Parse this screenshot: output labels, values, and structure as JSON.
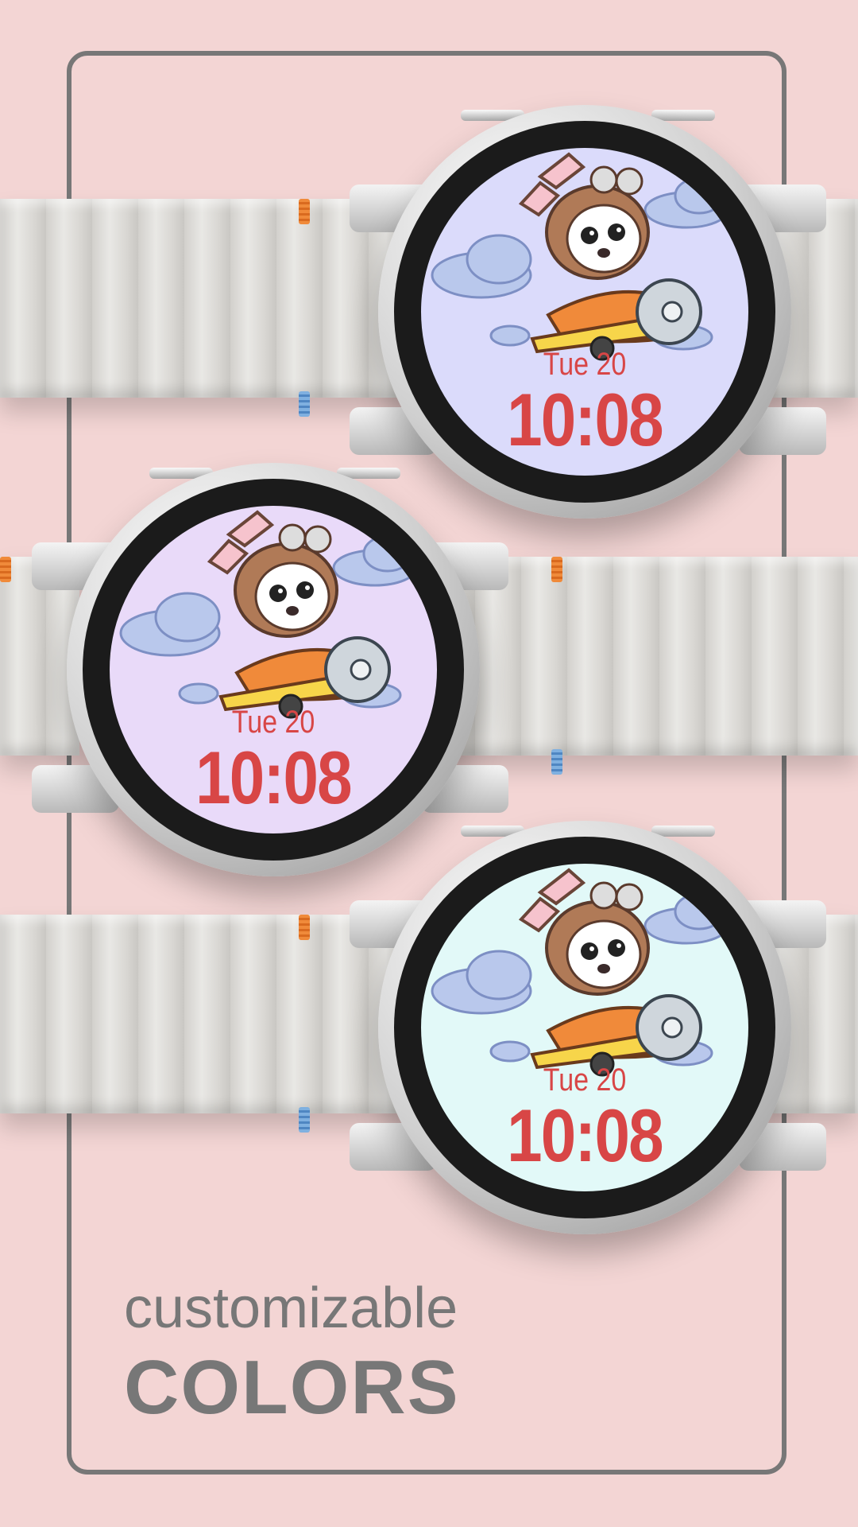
{
  "watches": [
    {
      "date": "Tue 20",
      "time": "10:08",
      "face_color": "#dbdbfb"
    },
    {
      "date": "Tue 20",
      "time": "10:08",
      "face_color": "#e9daf9"
    },
    {
      "date": "Tue 20",
      "time": "10:08",
      "face_color": "#e2f9f8"
    }
  ],
  "caption": {
    "line1": "customizable",
    "line2": "COLORS"
  },
  "colors": {
    "background": "#f3d5d4",
    "frame": "#777777",
    "time_text": "#d84646"
  },
  "illustration": "rabbit-pilot-airplane-icon"
}
